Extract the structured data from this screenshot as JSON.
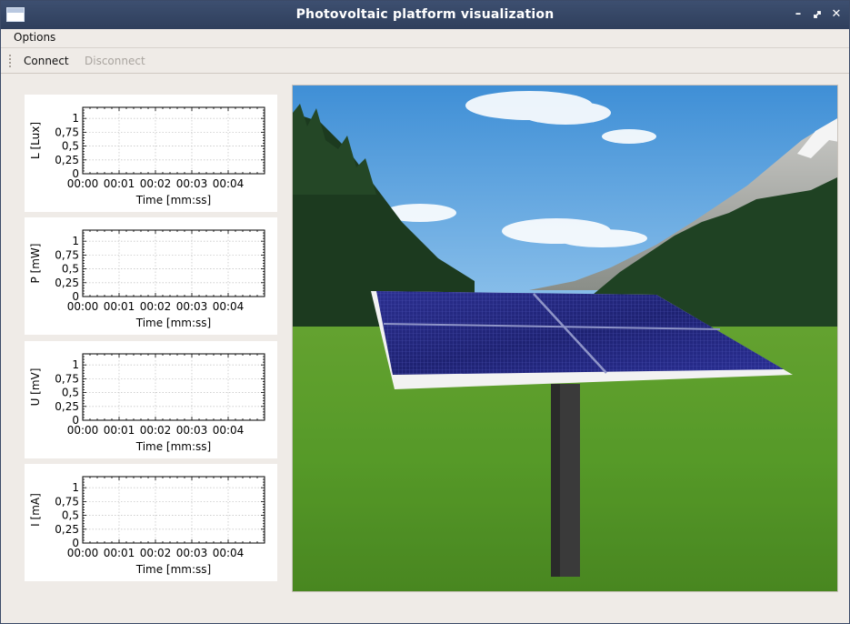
{
  "window": {
    "title": "Photovoltaic platform visualization"
  },
  "menu": {
    "options": "Options"
  },
  "toolbar": {
    "connect": "Connect",
    "disconnect": "Disconnect"
  },
  "colors": {
    "titlebar": "#2f3f5c",
    "window_bg": "#efebe7",
    "disabled_text": "#a9a49f"
  },
  "chart_data": [
    {
      "type": "line",
      "ylabel": "L [Lux]",
      "xlabel": "Time [mm:ss]",
      "x_ticks": [
        "00:00",
        "00:01",
        "00:02",
        "00:03",
        "00:04"
      ],
      "y_ticks": [
        "0",
        "0,25",
        "0,5",
        "0,75",
        "1"
      ],
      "ylim": [
        0,
        1.2
      ],
      "grid": true,
      "series": []
    },
    {
      "type": "line",
      "ylabel": "P [mW]",
      "xlabel": "Time [mm:ss]",
      "x_ticks": [
        "00:00",
        "00:01",
        "00:02",
        "00:03",
        "00:04"
      ],
      "y_ticks": [
        "0",
        "0,25",
        "0,5",
        "0,75",
        "1"
      ],
      "ylim": [
        0,
        1.2
      ],
      "grid": true,
      "series": []
    },
    {
      "type": "line",
      "ylabel": "U [mV]",
      "xlabel": "Time [mm:ss]",
      "x_ticks": [
        "00:00",
        "00:01",
        "00:02",
        "00:03",
        "00:04"
      ],
      "y_ticks": [
        "0",
        "0,25",
        "0,5",
        "0,75",
        "1"
      ],
      "ylim": [
        0,
        1.2
      ],
      "grid": true,
      "series": []
    },
    {
      "type": "line",
      "ylabel": "I [mA]",
      "xlabel": "Time [mm:ss]",
      "x_ticks": [
        "00:00",
        "00:01",
        "00:02",
        "00:03",
        "00:04"
      ],
      "y_ticks": [
        "0",
        "0,25",
        "0,5",
        "0,75",
        "1"
      ],
      "ylim": [
        0,
        1.2
      ],
      "grid": true,
      "series": []
    }
  ]
}
